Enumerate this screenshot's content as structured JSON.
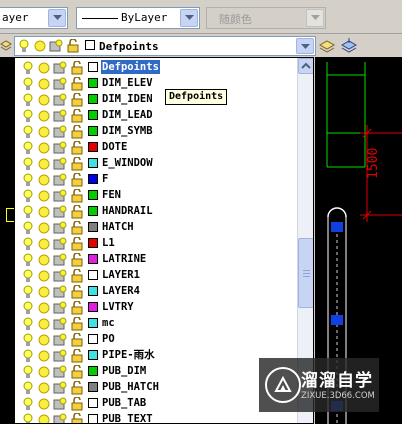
{
  "toolbar": {
    "layer_control_value": "ayer",
    "linetype_value": "ByLayer",
    "color_value": "随颜色"
  },
  "layer_combo": {
    "selected": "Defpoints"
  },
  "tooltip": "Defpoints",
  "layers": [
    {
      "name": "Defpoints",
      "color": "#ffffff",
      "selected": true
    },
    {
      "name": "DIM_ELEV",
      "color": "#00cc00"
    },
    {
      "name": "DIM_IDEN",
      "color": "#00cc00"
    },
    {
      "name": "DIM_LEAD",
      "color": "#00cc00"
    },
    {
      "name": "DIM_SYMB",
      "color": "#00cc00"
    },
    {
      "name": "DOTE",
      "color": "#e00000"
    },
    {
      "name": "E_WINDOW",
      "color": "#40e0e0"
    },
    {
      "name": "F",
      "color": "#0000e0"
    },
    {
      "name": "FEN",
      "color": "#00cc00"
    },
    {
      "name": "HANDRAIL",
      "color": "#00cc00"
    },
    {
      "name": "HATCH",
      "color": "#808080"
    },
    {
      "name": "L1",
      "color": "#e00000"
    },
    {
      "name": "LATRINE",
      "color": "#e020e0"
    },
    {
      "name": "LAYER1",
      "color": "#ffffff"
    },
    {
      "name": "LAYER4",
      "color": "#40e0e0"
    },
    {
      "name": "LVTRY",
      "color": "#e020e0"
    },
    {
      "name": "mc",
      "color": "#40e0e0"
    },
    {
      "name": "PO",
      "color": "#ffffff"
    },
    {
      "name": "PIPE-雨水",
      "color": "#40e0e0"
    },
    {
      "name": "PUB_DIM",
      "color": "#00cc00"
    },
    {
      "name": "PUB_HATCH",
      "color": "#808080"
    },
    {
      "name": "PUB_TAB",
      "color": "#ffffff"
    },
    {
      "name": "PUB_TEXT",
      "color": "#ffffff"
    }
  ],
  "drawing": {
    "dimension_text": "1500"
  },
  "watermark": {
    "brand": "溜溜自学",
    "url": "ZIXUE.3D66.COM"
  }
}
